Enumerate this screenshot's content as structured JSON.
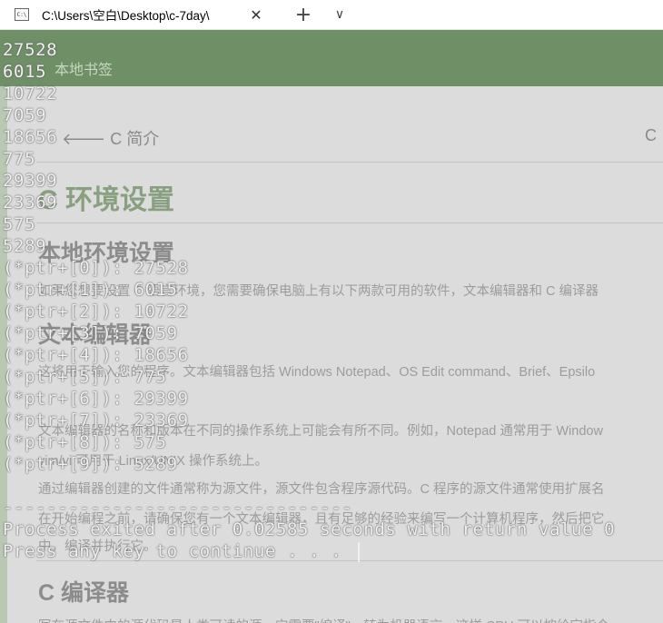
{
  "window": {
    "tab_title": "C:\\Users\\空白\\Desktop\\c-7day\\",
    "icon_text": "C:\\",
    "close_glyph": "✕",
    "new_tab_glyph": "+",
    "dropdown_glyph": "∨"
  },
  "background_page": {
    "bookmarks_label": "本地书签",
    "prev_link": "🡐 C 简介",
    "next_link": "C",
    "heading": "C 环境设置",
    "section1": "本地环境设置",
    "section1_text": "如果您想要设置 C 语言环境，您需要确保电脑上有以下两款可用的软件，文本编辑器和 C 编译器",
    "section2": "文本编辑器",
    "section2_text1": "这将用于输入您的程序。文本编辑器包括 Windows Notepad、OS Edit command、Brief、Epsilo",
    "section2_text2": "文本编辑器的名称和版本在不同的操作系统上可能会有所不同。例如，Notepad 通常用于 Window",
    "section2_text3": "vim/vi 可用于 Linux/UNIX 操作系统上。",
    "section2_text4": "通过编辑器创建的文件通常称为源文件，源文件包含程序源代码。C 程序的源文件通常使用扩展名",
    "section2_text5": "在开始编程之前，请确保您有一个文本编辑器，且有足够的经验来编写一个计算机程序，然后把它",
    "section2_text6": "中，编译并执行它。",
    "section3": "C 编译器",
    "section3_text": "写在源文件中的源代码是人类可读的源。它需要\"编译\"，转为机器语言，这样 CPU 可以按给定指令"
  },
  "console": {
    "values": [
      "27528",
      "6015",
      "10722",
      "7059",
      "18656",
      "775",
      "29399",
      "23369",
      "575",
      "5289"
    ],
    "ptr_lines": [
      "(*ptr+[0]): 27528",
      "(*ptr+[1]): 6015",
      "(*ptr+[2]): 10722",
      "(*ptr+[3]): 7059",
      "(*ptr+[4]): 18656",
      "(*ptr+[5]): 775",
      "(*ptr+[6]): 29399",
      "(*ptr+[7]): 23369",
      "(*ptr+[8]): 575",
      "(*ptr+[9]): 5289"
    ],
    "blank_line": "",
    "separator": "--------------------------------",
    "process_exit": "Process exited after 0.02585 seconds with return value 0",
    "press_key": "Press any key to continue . . . "
  }
}
